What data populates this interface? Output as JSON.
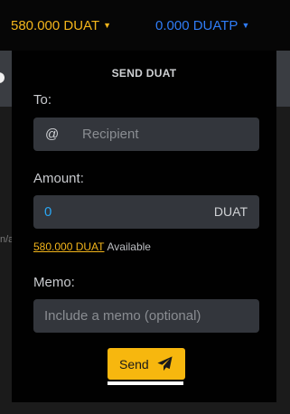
{
  "header": {
    "balance_duat": "580.000 DUAT",
    "balance_duatp": "0.000 DUATP",
    "caret": "▼"
  },
  "background": {
    "fragment": "n/a"
  },
  "send_panel": {
    "title": "SEND DUAT",
    "to_label": "To:",
    "recipient_prefix": "@",
    "recipient_placeholder": "Recipient",
    "amount_label": "Amount:",
    "amount_value": "0",
    "amount_unit": "DUAT",
    "available_amount": "580.000 DUAT",
    "available_suffix": "Available",
    "memo_label": "Memo:",
    "memo_placeholder": "Include a memo (optional)",
    "send_label": "Send",
    "send_icon": "paper-plane-icon"
  },
  "colors": {
    "accent_yellow": "#f7b70e",
    "balance_yellow": "#f3b51b",
    "balance_blue": "#2f7cf6",
    "amount_blue": "#2aa6f3"
  }
}
